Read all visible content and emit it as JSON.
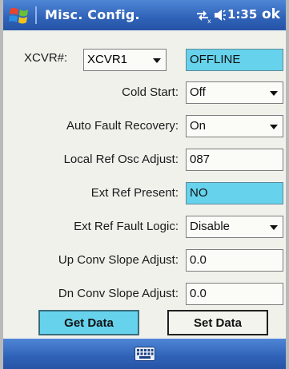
{
  "titlebar": {
    "title": "Misc. Config.",
    "time": "1:35",
    "ok_label": "ok",
    "icons": [
      "windows-flag-icon",
      "connectivity-icon",
      "volume-icon"
    ]
  },
  "xcvr": {
    "label": "XCVR#:",
    "selected": "XCVR1",
    "status": "OFFLINE"
  },
  "rows": [
    {
      "label": "Cold Start:",
      "value": "Off",
      "kind": "dropdown"
    },
    {
      "label": "Auto Fault Recovery:",
      "value": "On",
      "kind": "dropdown"
    },
    {
      "label": "Local Ref Osc Adjust:",
      "value": "087",
      "kind": "text"
    },
    {
      "label": "Ext Ref Present:",
      "value": "NO",
      "kind": "readonly"
    },
    {
      "label": "Ext Ref Fault Logic:",
      "value": "Disable",
      "kind": "dropdown"
    },
    {
      "label": "Up Conv Slope Adjust:",
      "value": "0.0",
      "kind": "text"
    },
    {
      "label": "Dn Conv Slope Adjust:",
      "value": "0.0",
      "kind": "text"
    }
  ],
  "buttons": {
    "get": "Get Data",
    "set": "Set Data"
  },
  "taskbar": {
    "icon": "keyboard-icon"
  },
  "colors": {
    "titlebar_blue": "#2f62b7",
    "highlight_cyan": "#67d2ec",
    "background": "#f1f1ec"
  }
}
